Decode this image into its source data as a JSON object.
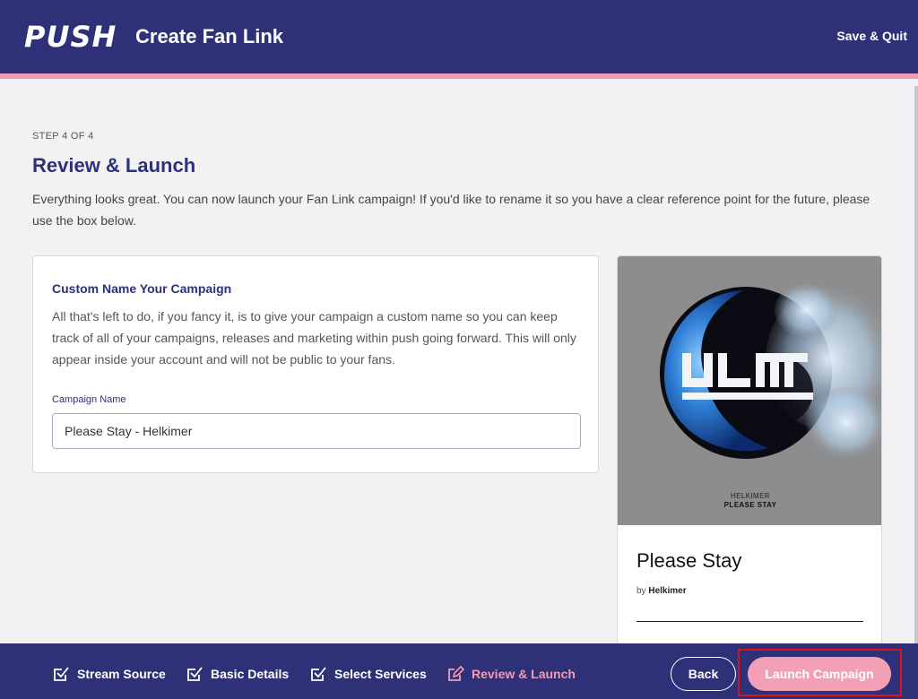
{
  "header": {
    "logo": "PUSH",
    "title": "Create Fan Link",
    "save_quit": "Save & Quit"
  },
  "step": {
    "label": "STEP 4 OF 4",
    "title": "Review & Launch",
    "intro": "Everything looks great. You can now launch your Fan Link campaign! If you'd like to rename it so you have a clear reference point for the future, please use the box below."
  },
  "custom_name_card": {
    "title": "Custom Name Your Campaign",
    "description": "All that's left to do, if you fancy it, is to give your campaign a custom name so you can keep track of all of your campaigns, releases and marketing within push going forward. This will only appear inside your account and will not be public to your fans.",
    "field_label": "Campaign Name",
    "field_value": "Please Stay - Helkimer"
  },
  "release": {
    "cover_artist": "HELKIMER",
    "cover_title": "PLEASE STAY",
    "title": "Please Stay",
    "by_prefix": "by",
    "artist": "Helkimer"
  },
  "footer": {
    "steps": [
      {
        "label": "Stream Source",
        "state": "done"
      },
      {
        "label": "Basic Details",
        "state": "done"
      },
      {
        "label": "Select Services",
        "state": "done"
      },
      {
        "label": "Review & Launch",
        "state": "active"
      }
    ],
    "back_label": "Back",
    "launch_label": "Launch Campaign"
  },
  "colors": {
    "brand_navy": "#2e3178",
    "accent_pink": "#f29bb2",
    "highlight_red": "#e0101b"
  }
}
